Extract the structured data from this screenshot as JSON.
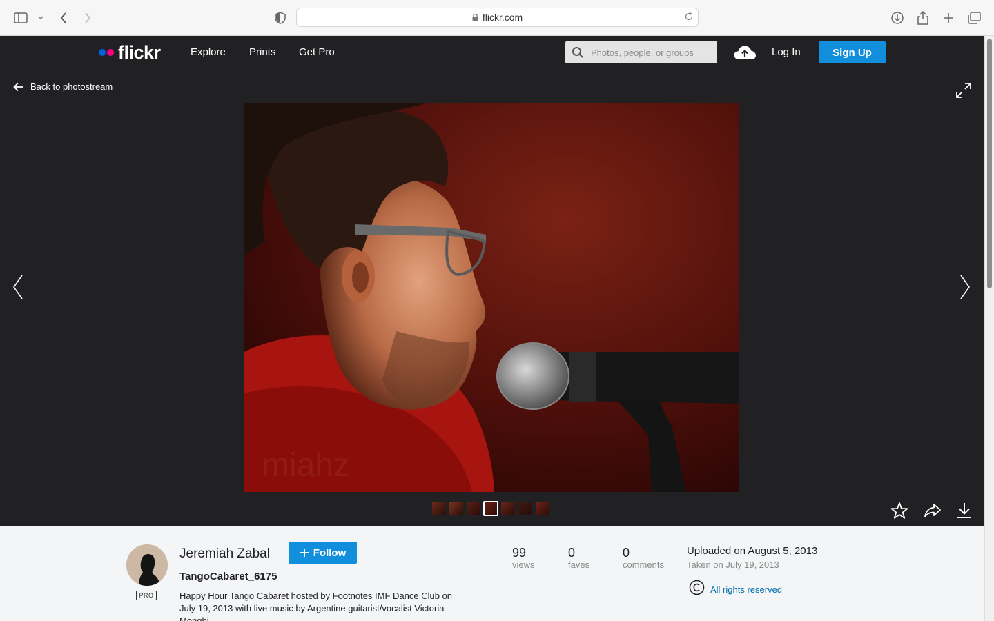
{
  "browser": {
    "url": "flickr.com"
  },
  "header": {
    "logo_text": "flickr",
    "nav": [
      {
        "label": "Explore"
      },
      {
        "label": "Prints"
      },
      {
        "label": "Get Pro"
      }
    ],
    "search_placeholder": "Photos, people, or groups",
    "login_label": "Log In",
    "signup_label": "Sign Up",
    "colors": {
      "dot_blue": "#0063dc",
      "dot_pink": "#ff0084",
      "accent": "#128fdc"
    }
  },
  "stage": {
    "back_label": "Back to photostream",
    "watermark": "miahz",
    "thumbnails": [
      {
        "color": "#6b2a1c",
        "active": false
      },
      {
        "color": "#7a3422",
        "active": false
      },
      {
        "color": "#5a2114",
        "active": false
      },
      {
        "color": "#6e1f16",
        "active": true
      },
      {
        "color": "#6a2518",
        "active": false
      },
      {
        "color": "#3d1a14",
        "active": false
      },
      {
        "color": "#6f2418",
        "active": false
      }
    ]
  },
  "info": {
    "author": "Jeremiah Zabal",
    "pro_label": "PRO",
    "follow_label": "Follow",
    "photo_title": "TangoCabaret_6175",
    "description": "Happy Hour Tango Cabaret hosted by Footnotes IMF Dance Club on July 19, 2013 with live music by Argentine guitarist/vocalist Victoria Mongbi",
    "stats": [
      {
        "value": "99",
        "label": "views"
      },
      {
        "value": "0",
        "label": "faves"
      },
      {
        "value": "0",
        "label": "comments"
      }
    ],
    "uploaded": "Uploaded on August 5, 2013",
    "taken": "Taken on July 19, 2013",
    "rights": "All rights reserved"
  }
}
